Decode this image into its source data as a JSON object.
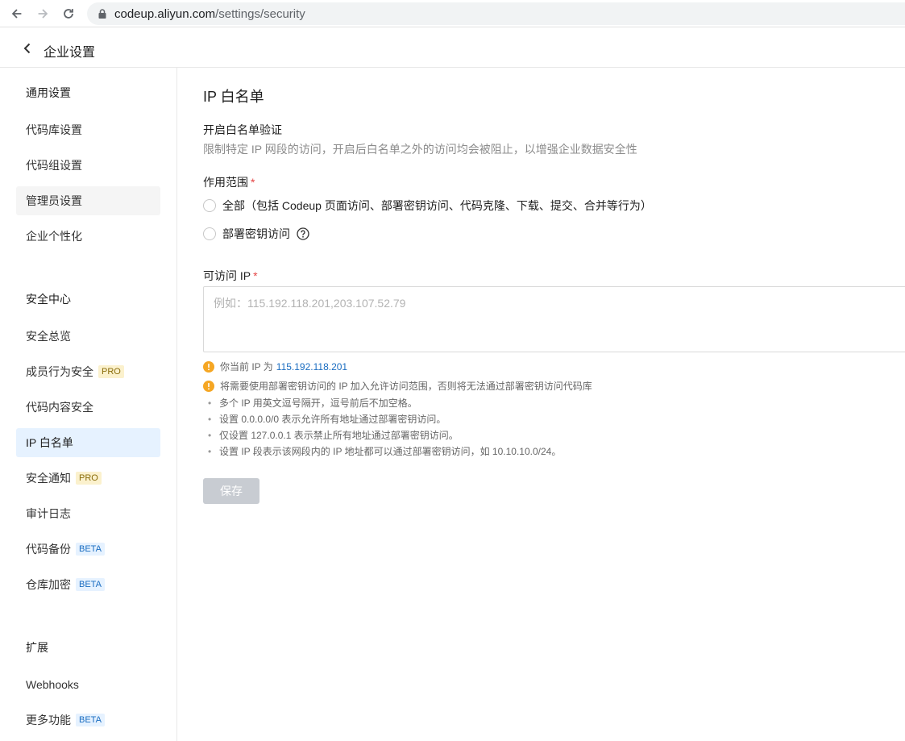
{
  "browser": {
    "url_host": "codeup.aliyun.com",
    "url_path": "/settings/security"
  },
  "header": {
    "title": "企业设置"
  },
  "sidebar": {
    "items": [
      {
        "label": "通用设置",
        "type": "section"
      },
      {
        "label": "代码库设置"
      },
      {
        "label": "代码组设置"
      },
      {
        "label": "管理员设置"
      },
      {
        "label": "企业个性化"
      },
      {
        "label": "安全中心",
        "type": "section"
      },
      {
        "label": "安全总览"
      },
      {
        "label": "成员行为安全",
        "badge": "PRO"
      },
      {
        "label": "代码内容安全"
      },
      {
        "label": "IP 白名单",
        "active": true
      },
      {
        "label": "安全通知",
        "badge": "PRO"
      },
      {
        "label": "审计日志"
      },
      {
        "label": "代码备份",
        "badge": "BETA"
      },
      {
        "label": "仓库加密",
        "badge": "BETA"
      },
      {
        "label": "扩展",
        "type": "section"
      },
      {
        "label": "Webhooks"
      },
      {
        "label": "更多功能",
        "badge": "BETA"
      }
    ]
  },
  "main": {
    "title": "IP 白名单",
    "section_title": "开启白名单验证",
    "section_desc": "限制特定 IP 网段的访问，开启后白名单之外的访问均会被阻止，以增强企业数据安全性",
    "scope_label": "作用范围",
    "required_mark": "*",
    "scope_options": [
      {
        "label": "全部（包括 Codeup 页面访问、部署密钥访问、代码克隆、下载、提交、合并等行为）",
        "selected": false
      },
      {
        "label": "部署密钥访问",
        "selected": false
      }
    ],
    "ip_label": "可访问 IP",
    "ip_placeholder": "例如：115.192.118.201,203.107.52.79",
    "ip_value": "",
    "current_ip_text": "你当前 IP 为",
    "current_ip": "115.192.118.201",
    "deploy_tip": "将需要使用部署密钥访问的 IP 加入允许访问范围，否则将无法通过部署密钥访问代码库",
    "bullets": [
      "多个 IP 用英文逗号隔开，逗号前后不加空格。",
      "设置 0.0.0.0/0 表示允许所有地址通过部署密钥访问。",
      "仅设置 127.0.0.1 表示禁止所有地址通过部署密钥访问。",
      "设置 IP 段表示该网段内的 IP 地址都可以通过部署密钥访问，如 10.10.10.0/24。"
    ],
    "save_label": "保存"
  },
  "colors": {
    "active_bg": "#e6f2ff",
    "link": "#1b6dc1",
    "warning": "#f5a623",
    "required": "#e54545",
    "disabled_button": "#c8ccd2"
  }
}
